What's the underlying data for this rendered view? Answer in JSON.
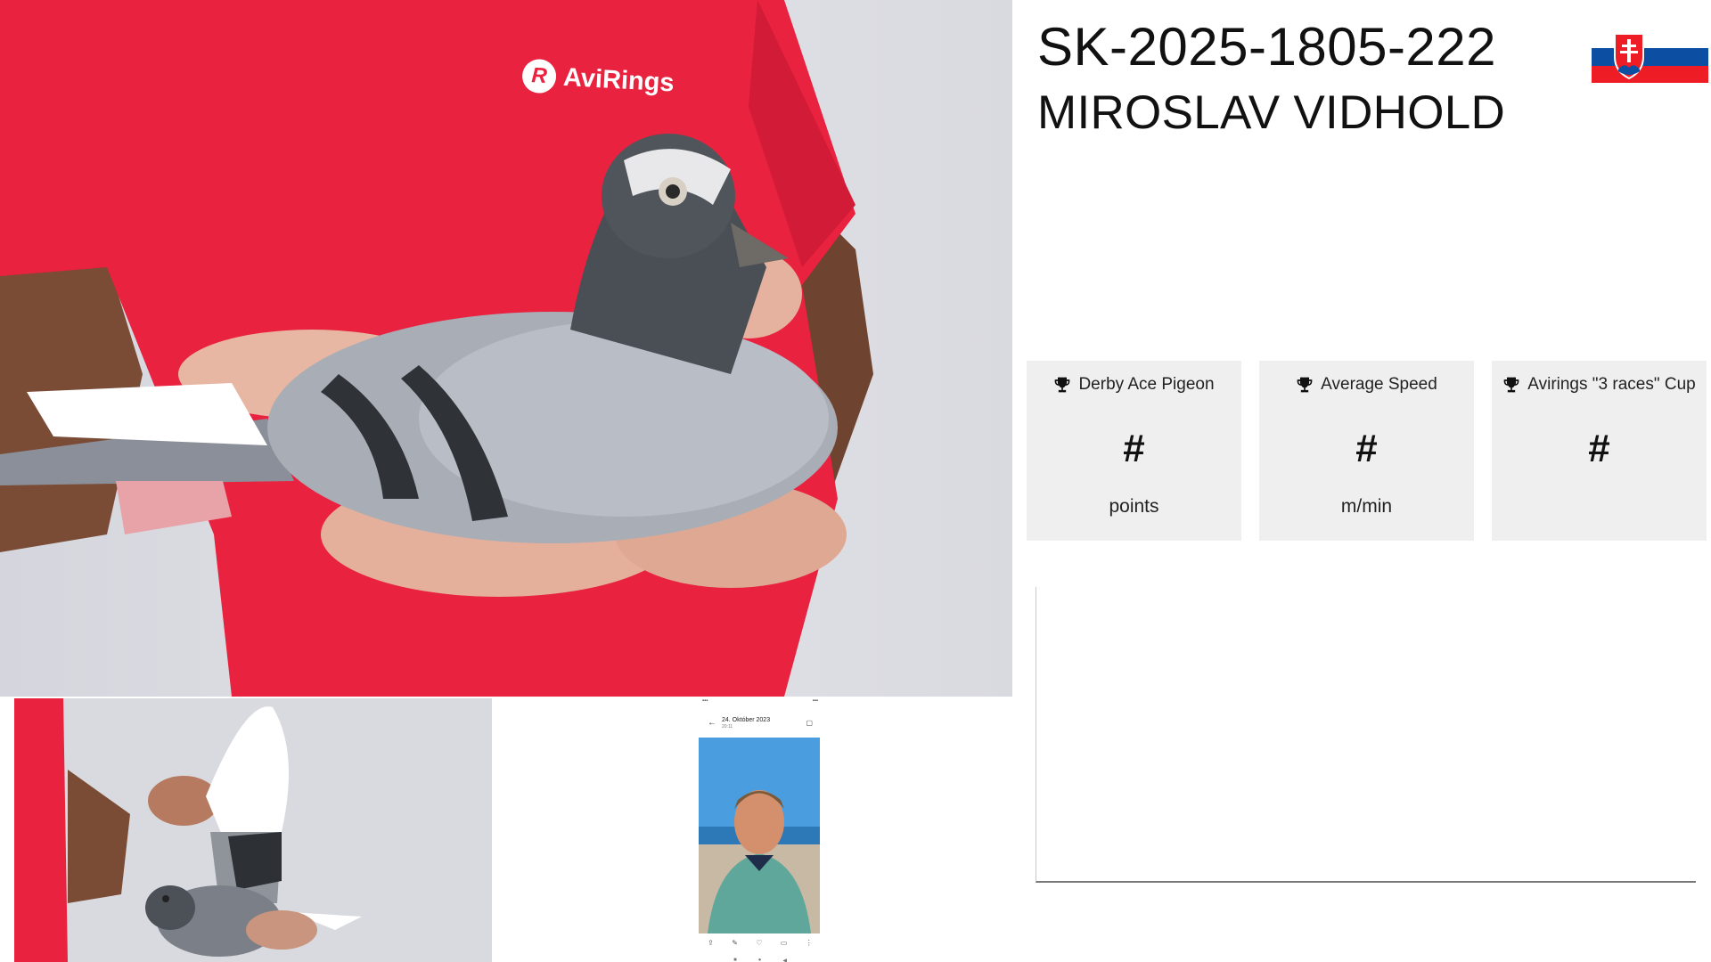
{
  "pigeon": {
    "ring_id": "SK-2025-1805-222",
    "owner": "MIROSLAV VIDHOLD",
    "country_flag": "slovakia-flag"
  },
  "photos": {
    "main_logo_text": "AviRings",
    "phone_date": "24. Október 2023",
    "phone_time": "20:11"
  },
  "stats": [
    {
      "title": "Derby Ace Pigeon",
      "value": "#",
      "unit": "points",
      "icon": "trophy-icon"
    },
    {
      "title": "Average Speed",
      "value": "#",
      "unit": "m/min",
      "icon": "trophy-icon"
    },
    {
      "title": "Avirings \"3 races\" Cup",
      "value": "#",
      "unit": "",
      "icon": "trophy-icon"
    }
  ],
  "colors": {
    "card_bg": "#efefef",
    "shirt_red": "#e8223f",
    "flag_white": "#ffffff",
    "flag_blue": "#0b4ea2",
    "flag_red": "#ee1c25"
  }
}
